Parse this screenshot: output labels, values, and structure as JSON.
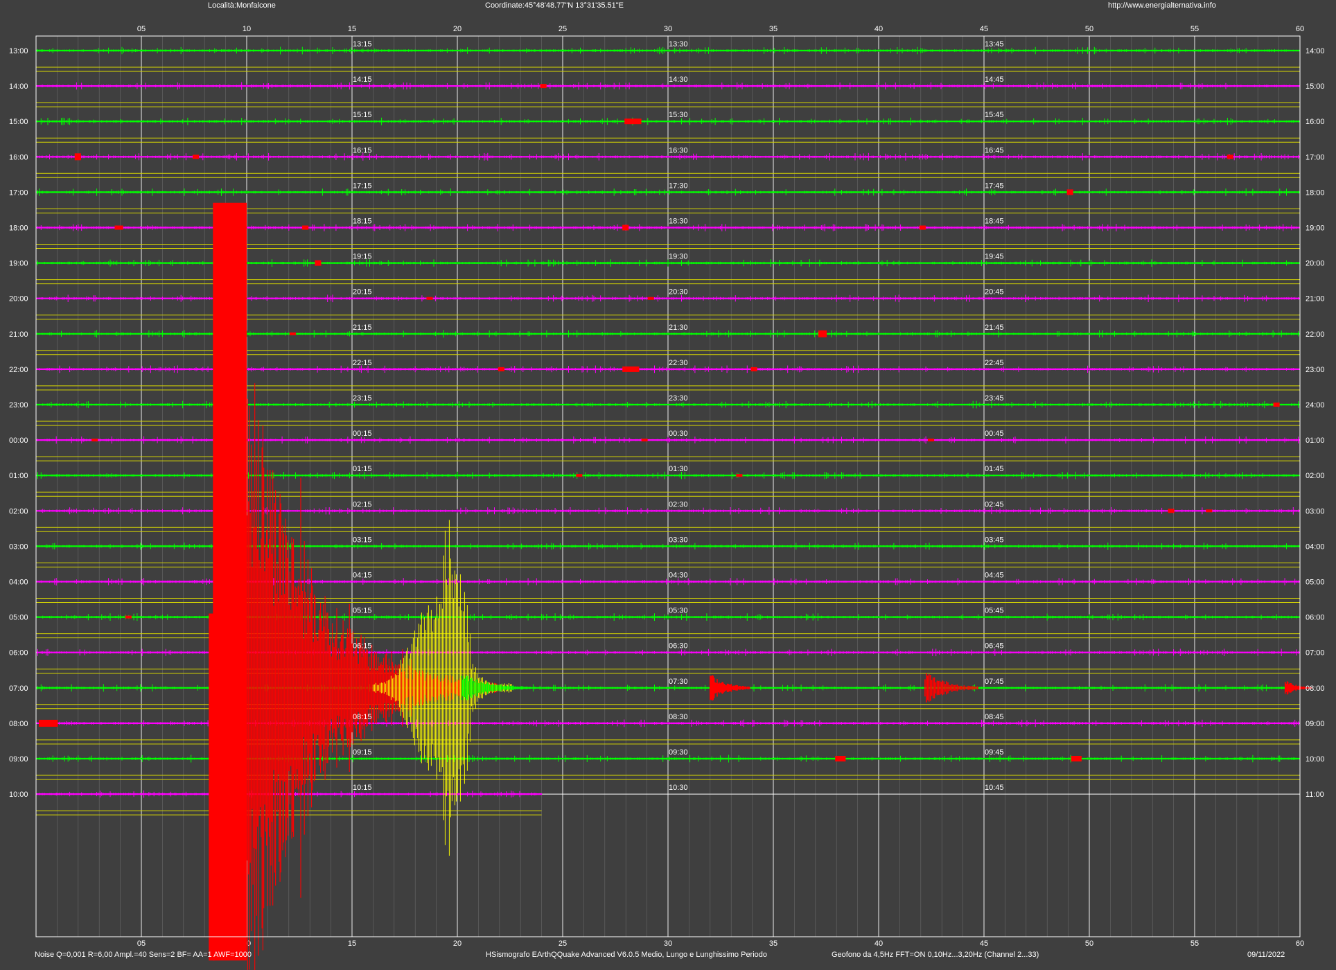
{
  "header": {
    "location": "Località:Monfalcone",
    "coordinates": "Coordinate:45°48'48.77\"N  13°31'35.51\"E",
    "url": "http://www.energialternativa.info"
  },
  "footer": {
    "settings": "Noise Q=0,001 R=6,00 Ampl.=40 Sens=2 BF= AA=1 AWF=1000",
    "software": "HSismografo  EArthQQuake Advanced V6.0.5  Medio, Lungo e Lunghissimo Periodo",
    "sensor": "Geofono da 4,5Hz FFT=ON 0,10Hz...3,20Hz      (Channel 2...33)",
    "date": "09/11/2022"
  },
  "colors": {
    "background": "#3f3f3f",
    "odd_trace": "#00ff00",
    "even_trace": "#ff00ff",
    "event": "#ff0000",
    "surface_wave": "#ffff00",
    "separator": "#d8d800",
    "grid_major": "#ffffff",
    "grid_minor": "#8a8a8a"
  },
  "chart_data": {
    "type": "seismogram-helicorder",
    "x_unit": "minutes",
    "xlim": [
      0,
      60
    ],
    "x_ticks": [
      "05",
      "10",
      "15",
      "20",
      "25",
      "30",
      "35",
      "40",
      "45",
      "50",
      "55",
      "60"
    ],
    "rows": [
      {
        "start": "13:00",
        "end": "14:00",
        "q": [
          "13:15",
          "13:30",
          "13:45"
        ],
        "color": "green"
      },
      {
        "start": "14:00",
        "end": "15:00",
        "q": [
          "14:15",
          "14:30",
          "14:45"
        ],
        "color": "magenta"
      },
      {
        "start": "15:00",
        "end": "16:00",
        "q": [
          "15:15",
          "15:30",
          "15:45"
        ],
        "color": "green"
      },
      {
        "start": "16:00",
        "end": "17:00",
        "q": [
          "16:15",
          "16:30",
          "16:45"
        ],
        "color": "magenta"
      },
      {
        "start": "17:00",
        "end": "18:00",
        "q": [
          "17:15",
          "17:30",
          "17:45"
        ],
        "color": "green"
      },
      {
        "start": "18:00",
        "end": "19:00",
        "q": [
          "18:15",
          "18:30",
          "18:45"
        ],
        "color": "magenta"
      },
      {
        "start": "19:00",
        "end": "20:00",
        "q": [
          "19:15",
          "19:30",
          "19:45"
        ],
        "color": "green"
      },
      {
        "start": "20:00",
        "end": "21:00",
        "q": [
          "20:15",
          "20:30",
          "20:45"
        ],
        "color": "magenta"
      },
      {
        "start": "21:00",
        "end": "22:00",
        "q": [
          "21:15",
          "21:30",
          "21:45"
        ],
        "color": "green"
      },
      {
        "start": "22:00",
        "end": "23:00",
        "q": [
          "22:15",
          "22:30",
          "22:45"
        ],
        "color": "magenta"
      },
      {
        "start": "23:00",
        "end": "24:00",
        "q": [
          "23:15",
          "23:30",
          "23:45"
        ],
        "color": "green"
      },
      {
        "start": "00:00",
        "end": "01:00",
        "q": [
          "00:15",
          "00:30",
          "00:45"
        ],
        "color": "magenta"
      },
      {
        "start": "01:00",
        "end": "02:00",
        "q": [
          "01:15",
          "01:30",
          "01:45"
        ],
        "color": "green"
      },
      {
        "start": "02:00",
        "end": "03:00",
        "q": [
          "02:15",
          "02:30",
          "02:45"
        ],
        "color": "magenta"
      },
      {
        "start": "03:00",
        "end": "04:00",
        "q": [
          "03:15",
          "03:30",
          "03:45"
        ],
        "color": "green"
      },
      {
        "start": "04:00",
        "end": "05:00",
        "q": [
          "04:15",
          "04:30",
          "04:45"
        ],
        "color": "magenta"
      },
      {
        "start": "05:00",
        "end": "06:00",
        "q": [
          "05:15",
          "05:30",
          "05:45"
        ],
        "color": "green"
      },
      {
        "start": "06:00",
        "end": "07:00",
        "q": [
          "06:15",
          "06:30",
          "06:45"
        ],
        "color": "magenta"
      },
      {
        "start": "07:00",
        "end": "08:00",
        "q": [
          "",
          "07:30",
          "07:45"
        ],
        "color": "green"
      },
      {
        "start": "08:00",
        "end": "09:00",
        "q": [
          "08:15",
          "08:30",
          "08:45"
        ],
        "color": "magenta"
      },
      {
        "start": "09:00",
        "end": "10:00",
        "q": [
          "09:15",
          "09:30",
          "09:45"
        ],
        "color": "green"
      },
      {
        "start": "10:00",
        "end": "11:00",
        "q": [
          "10:15",
          "10:30",
          "10:45"
        ],
        "color": "magenta"
      }
    ],
    "trace_end_last_row_min": 24,
    "events": [
      {
        "row": 0,
        "minute": 0,
        "kind": "none"
      },
      {
        "row": 1,
        "minute": 24.0,
        "kind": "spot",
        "amp": 3
      },
      {
        "row": 2,
        "minute": 28.0,
        "kind": "spot",
        "amp": 4,
        "len": 0.8
      },
      {
        "row": 3,
        "minute": 1.9,
        "kind": "spot",
        "amp": 5
      },
      {
        "row": 3,
        "minute": 7.5,
        "kind": "spot",
        "amp": 3
      },
      {
        "row": 3,
        "minute": 56.6,
        "kind": "spot",
        "amp": 3
      },
      {
        "row": 4,
        "minute": 49.0,
        "kind": "spot",
        "amp": 4
      },
      {
        "row": 5,
        "minute": 3.8,
        "kind": "spot",
        "amp": 3,
        "len": 0.4
      },
      {
        "row": 5,
        "minute": 12.7,
        "kind": "spot",
        "amp": 3
      },
      {
        "row": 5,
        "minute": 27.9,
        "kind": "spot",
        "amp": 4
      },
      {
        "row": 5,
        "minute": 42.0,
        "kind": "spot",
        "amp": 3
      },
      {
        "row": 6,
        "minute": 13.3,
        "kind": "spot",
        "amp": 4
      },
      {
        "row": 7,
        "minute": 18.6,
        "kind": "spot",
        "amp": 2
      },
      {
        "row": 7,
        "minute": 29.1,
        "kind": "spot",
        "amp": 2
      },
      {
        "row": 8,
        "minute": 12.1,
        "kind": "spot",
        "amp": 2
      },
      {
        "row": 8,
        "minute": 37.2,
        "kind": "spot",
        "amp": 5,
        "len": 0.4
      },
      {
        "row": 9,
        "minute": 22.0,
        "kind": "spot",
        "amp": 3
      },
      {
        "row": 9,
        "minute": 27.9,
        "kind": "spot",
        "amp": 4,
        "len": 0.8
      },
      {
        "row": 9,
        "minute": 34.0,
        "kind": "spot",
        "amp": 3
      },
      {
        "row": 10,
        "minute": 58.8,
        "kind": "spot",
        "amp": 3
      },
      {
        "row": 11,
        "minute": 2.7,
        "kind": "spot",
        "amp": 2
      },
      {
        "row": 11,
        "minute": 28.8,
        "kind": "spot",
        "amp": 2
      },
      {
        "row": 11,
        "minute": 42.4,
        "kind": "spot",
        "amp": 2
      },
      {
        "row": 12,
        "minute": 25.7,
        "kind": "spot",
        "amp": 2
      },
      {
        "row": 12,
        "minute": 33.3,
        "kind": "spot",
        "amp": 2
      },
      {
        "row": 13,
        "minute": 53.8,
        "kind": "spot",
        "amp": 3
      },
      {
        "row": 13,
        "minute": 55.6,
        "kind": "spot",
        "amp": 2
      },
      {
        "row": 16,
        "minute": 4.3,
        "kind": "spot",
        "amp": 2
      },
      {
        "row": 18,
        "minute": 32.0,
        "kind": "burst",
        "amp": 22,
        "len": 1.2
      },
      {
        "row": 18,
        "minute": 42.2,
        "kind": "burst",
        "amp": 26,
        "len": 1.6
      },
      {
        "row": 18,
        "minute": 59.3,
        "kind": "burst",
        "amp": 12,
        "len": 0.8
      },
      {
        "row": 19,
        "minute": 0.2,
        "kind": "spot",
        "amp": 5,
        "len": 0.9
      },
      {
        "row": 20,
        "minute": 38.0,
        "kind": "spot",
        "amp": 4,
        "len": 0.5
      },
      {
        "row": 20,
        "minute": 49.2,
        "kind": "spot",
        "amp": 4,
        "len": 0.5
      }
    ],
    "earthquake": {
      "start_minute": 8.2,
      "peak_end_minute": 10.0,
      "decay_end_minute": 22.0,
      "top_row": 4.3,
      "bottom_row": 25.7,
      "surface_wave_start": 16.0,
      "surface_wave_end": 22.6
    }
  }
}
